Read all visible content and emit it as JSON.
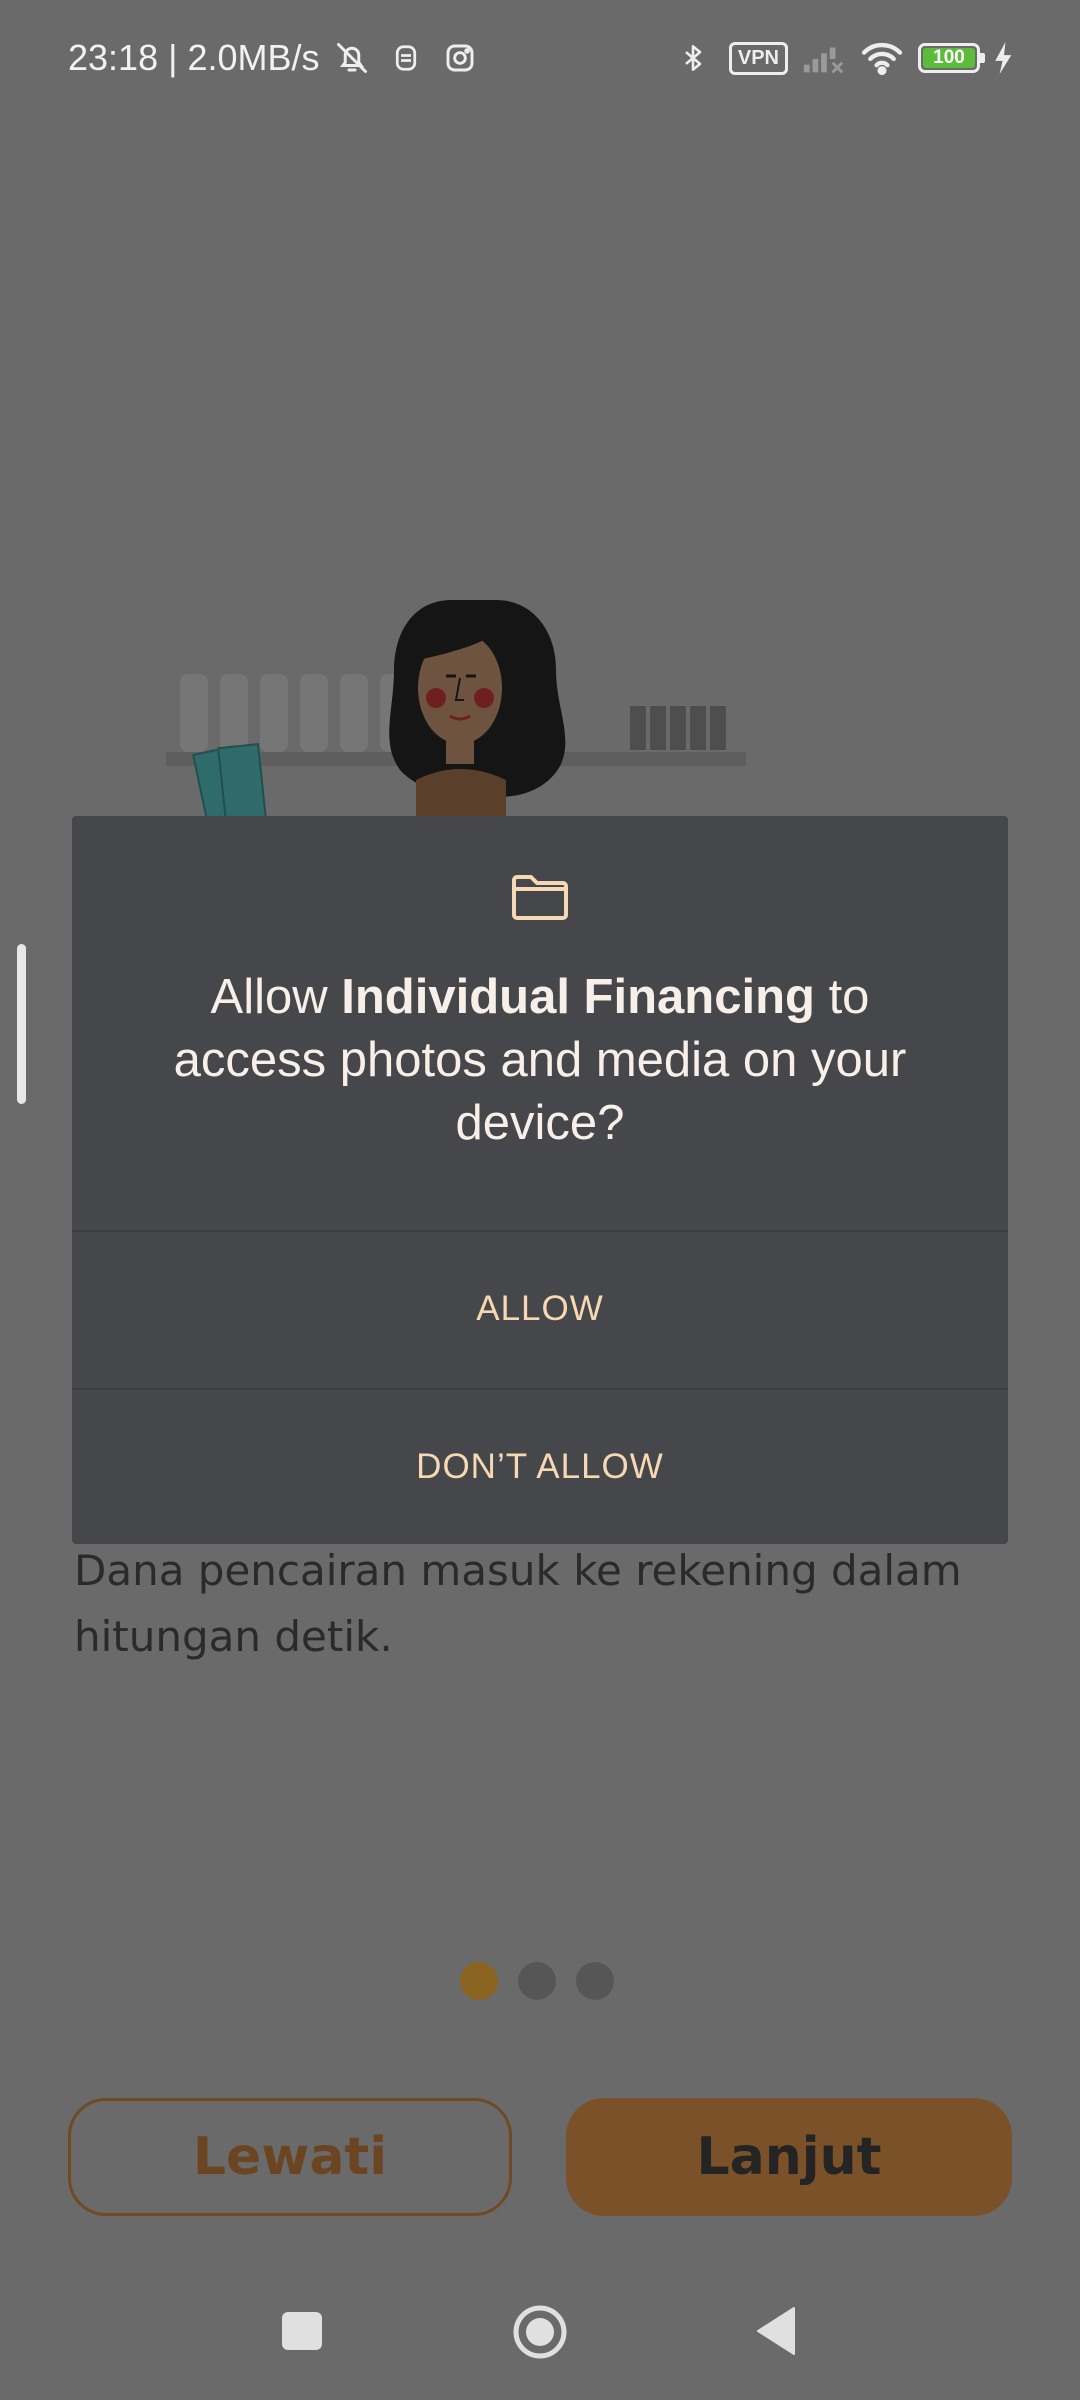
{
  "status_bar": {
    "time": "23:18 | 2.0MB/s",
    "icons_left": [
      "bell-off-icon",
      "vpn-key-icon",
      "instagram-icon"
    ],
    "icons_right": [
      "bluetooth-icon",
      "vpn-badge",
      "signal-icon",
      "wifi-icon",
      "battery-icon",
      "charging-icon"
    ],
    "vpn_label": "VPN",
    "battery_level": "100"
  },
  "onboarding": {
    "description": "Dana pencairan masuk ke rekening dalam hitungan detik.",
    "page_indicator": {
      "total": 3,
      "active": 1
    },
    "skip_label": "Lewati",
    "next_label": "Lanjut"
  },
  "dialog": {
    "icon": "folder-icon",
    "title_prefix": "Allow ",
    "app_name": "Individual Financing",
    "title_suffix": " to access photos and media on your device?",
    "allow_label": "ALLOW",
    "deny_label": "DON’T ALLOW"
  },
  "colors": {
    "scrim_background": "#6a6a6a",
    "dialog_background": "#45474a",
    "dialog_button_text": "#f6d9b3",
    "accent_brown": "#7a5128"
  },
  "nav_bar": {
    "icons": [
      "recent-apps-icon",
      "home-icon",
      "back-icon"
    ]
  }
}
